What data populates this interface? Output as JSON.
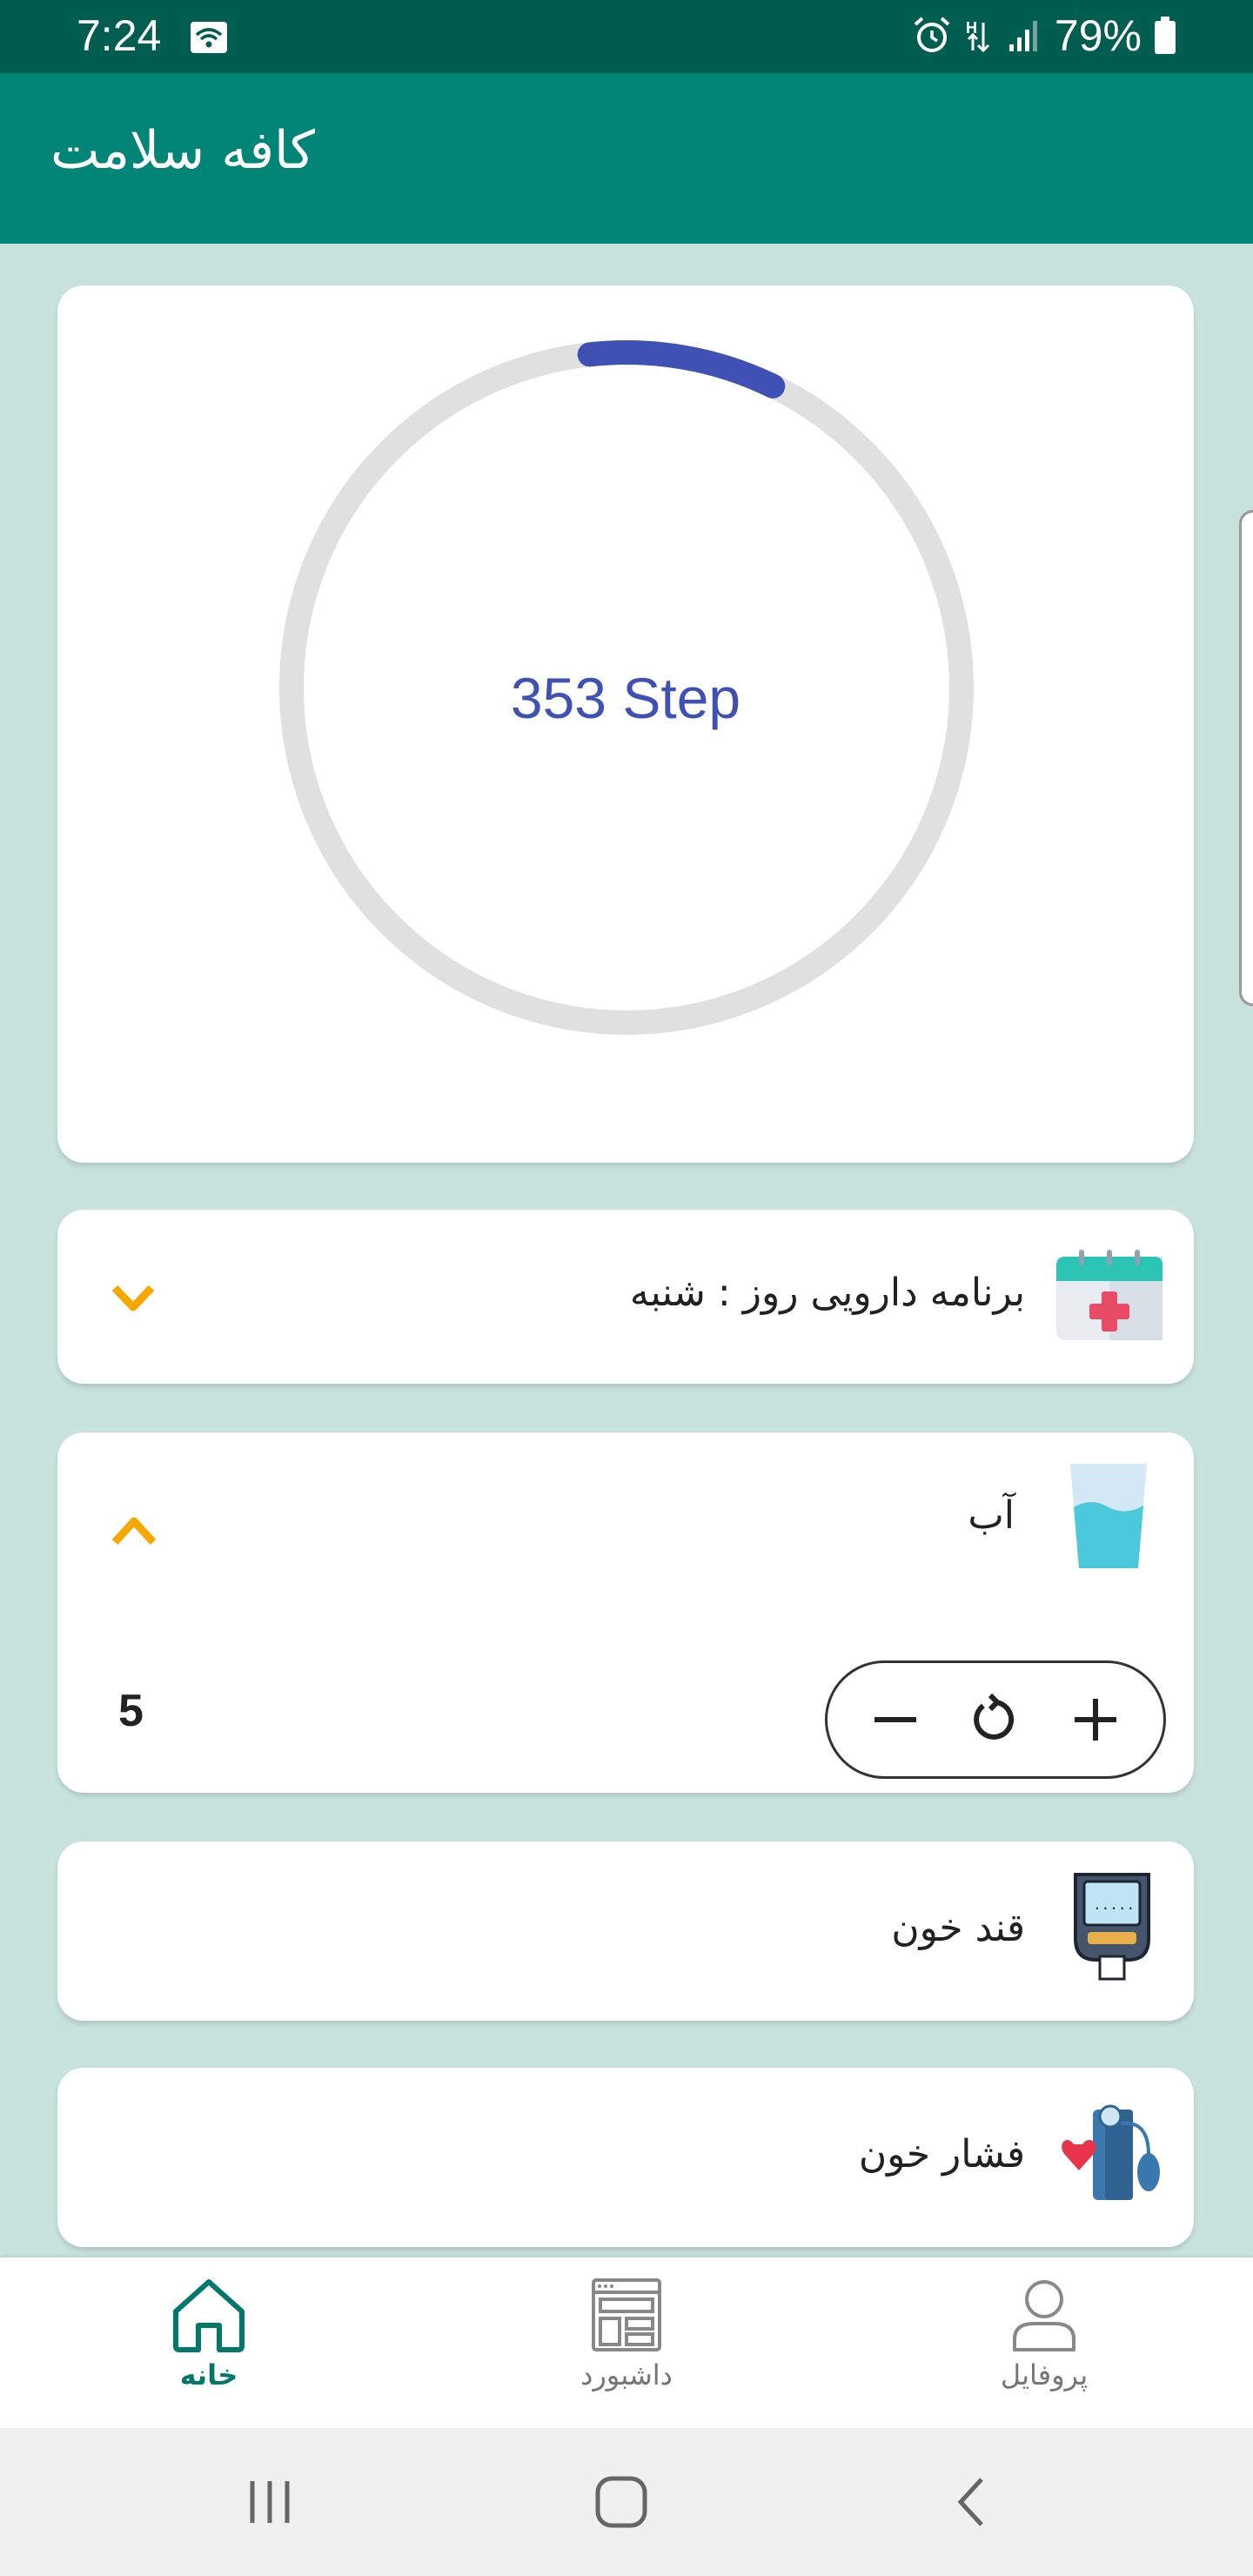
{
  "status_bar": {
    "time": "7:24",
    "battery": "79%"
  },
  "app_bar": {
    "title": "کافه سلامت"
  },
  "steps": {
    "label": "353 Step",
    "progress": 0.12,
    "ring_color": "#3f51b5",
    "track_color": "#e0e0e0"
  },
  "medication": {
    "title": "برنامه دارویی روز :  شنبه",
    "icon": "calendar-medical-icon",
    "chevron": "chevron-down-icon"
  },
  "water": {
    "title": "آب",
    "icon": "water-glass-icon",
    "chevron": "chevron-up-icon",
    "count": "5",
    "controls": [
      "minus-icon",
      "reset-icon",
      "plus-icon"
    ]
  },
  "blood_sugar": {
    "title": "قند خون",
    "icon": "glucometer-icon"
  },
  "blood_pressure": {
    "title": "فشار خون",
    "icon": "blood-pressure-monitor-icon"
  },
  "bottom_nav": {
    "items": [
      {
        "label": "خانه",
        "icon": "home-icon",
        "active": true
      },
      {
        "label": "داشبورد",
        "icon": "dashboard-icon",
        "active": false
      },
      {
        "label": "پروفایل",
        "icon": "profile-icon",
        "active": false
      }
    ]
  },
  "colors": {
    "status_bar": "#005d4f",
    "app_bar": "#008577",
    "background": "#c8e2de",
    "accent_orange": "#f6a800",
    "active_nav": "#00796b"
  }
}
